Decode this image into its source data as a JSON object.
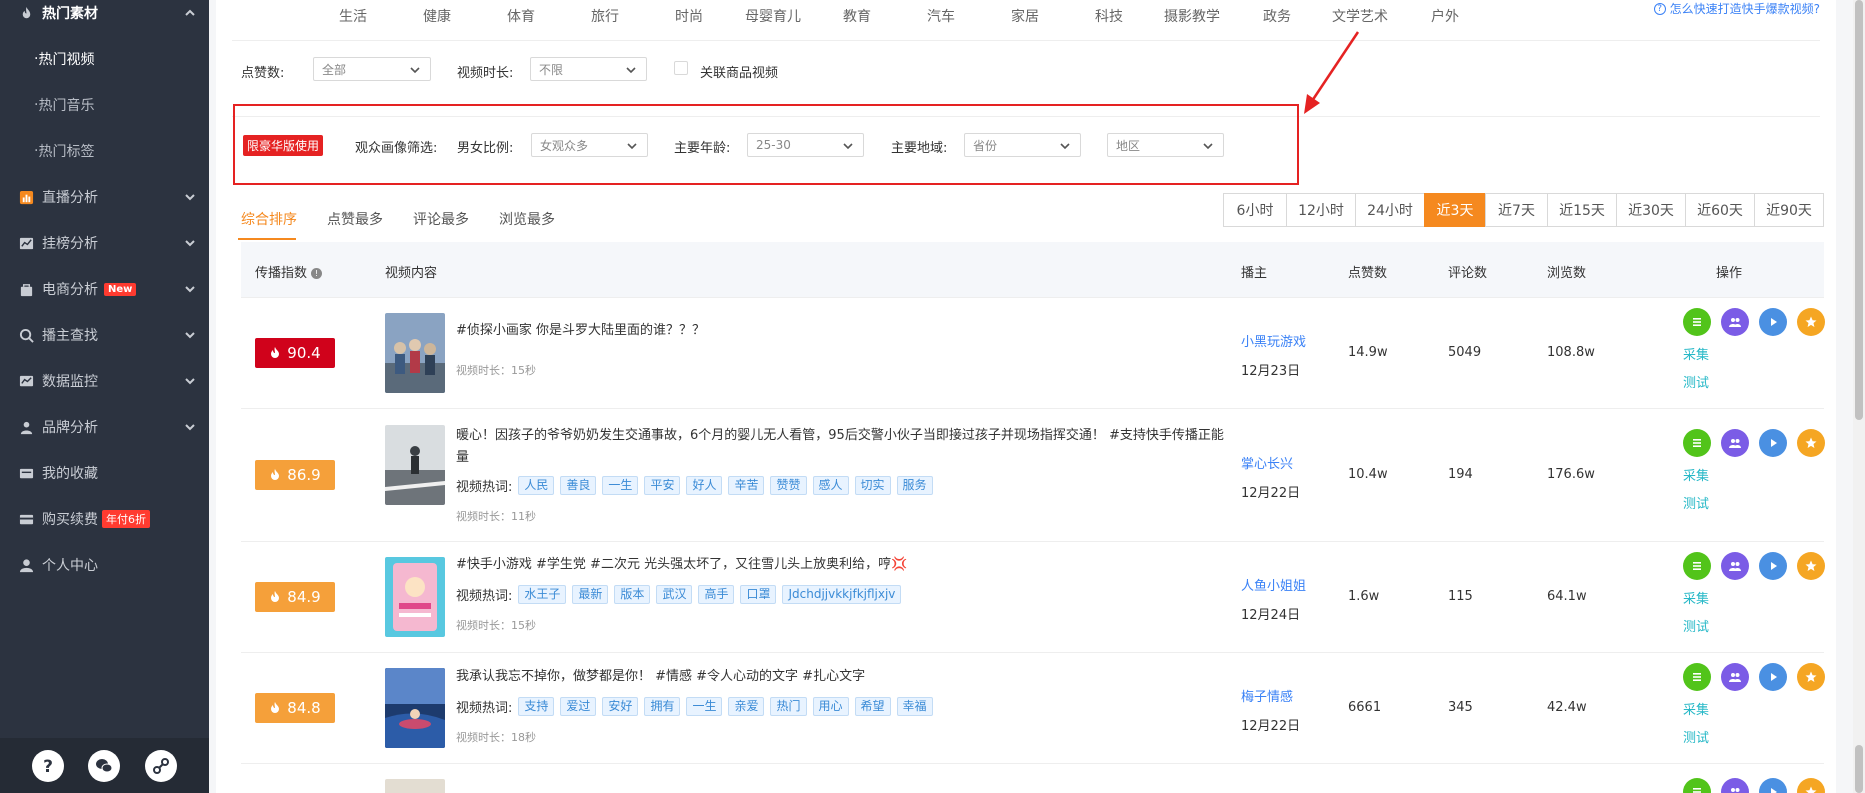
{
  "sidebar": {
    "items": [
      {
        "label": "热门素材",
        "icon": "flame-icon",
        "expanded": true
      },
      {
        "label": "热门视频",
        "sub": true,
        "active": true
      },
      {
        "label": "热门音乐",
        "sub": true
      },
      {
        "label": "热门标签",
        "sub": true
      },
      {
        "label": "直播分析",
        "icon": "bar-chart-icon"
      },
      {
        "label": "挂榜分析",
        "icon": "line-chart-icon"
      },
      {
        "label": "电商分析",
        "icon": "bag-icon",
        "badge": "New"
      },
      {
        "label": "播主查找",
        "icon": "search-icon"
      },
      {
        "label": "数据监控",
        "icon": "monitor-icon"
      },
      {
        "label": "品牌分析",
        "icon": "brand-icon"
      },
      {
        "label": "我的收藏",
        "icon": "collect-icon"
      },
      {
        "label": "购买续费",
        "icon": "card-icon",
        "badge": "年付6折"
      },
      {
        "label": "个人中心",
        "icon": "user-icon"
      }
    ],
    "bottom_icons": [
      "help-icon",
      "wechat-icon",
      "link-icon"
    ]
  },
  "categories": [
    "生活",
    "健康",
    "体育",
    "旅行",
    "时尚",
    "母婴育儿",
    "教育",
    "汽车",
    "家居",
    "科技",
    "摄影教学",
    "政务",
    "文学艺术",
    "户外"
  ],
  "help_link": "怎么快速打造快手爆款视频?",
  "filters": {
    "likes_label": "点赞数:",
    "likes_value": "全部",
    "duration_label": "视频时长:",
    "duration_value": "不限",
    "goods_label": "关联商品视频"
  },
  "audience": {
    "badge": "限豪华版使用",
    "label": "观众画像筛选:",
    "gender_label": "男女比例:",
    "gender_value": "女观众多",
    "age_label": "主要年龄:",
    "age_value": "25-30",
    "region_label": "主要地域:",
    "province_value": "省份",
    "area_value": "地区"
  },
  "tabs": [
    "综合排序",
    "点赞最多",
    "评论最多",
    "浏览最多"
  ],
  "time_ranges": [
    "6小时",
    "12小时",
    "24小时",
    "近3天",
    "近7天",
    "近15天",
    "近30天",
    "近60天",
    "近90天"
  ],
  "active_time": "近3天",
  "table": {
    "headers": [
      "传播指数",
      "视频内容",
      "播主",
      "点赞数",
      "评论数",
      "浏览数",
      "操作"
    ],
    "tags_label": "视频热词:",
    "rows": [
      {
        "score": "90.4",
        "color": "red",
        "title": "#侦探小画家 你是斗罗大陆里面的谁？？？",
        "tags": [],
        "duration": "视频时长：15秒",
        "author": "小黑玩游戏",
        "date": "12月23日",
        "likes": "14.9w",
        "comments": "5049",
        "views": "108.8w"
      },
      {
        "score": "86.9",
        "color": "orange",
        "title": "暖心！因孩子的爷爷奶奶发生交通事故，6个月的婴儿无人看管，95后交警小伙子当即接过孩子并现场指挥交通！ #支持快手传播正能量",
        "tags": [
          "人民",
          "善良",
          "一生",
          "平安",
          "好人",
          "辛苦",
          "赞赞",
          "感人",
          "切实",
          "服务"
        ],
        "duration": "视频时长：11秒",
        "author": "掌心长兴",
        "date": "12月22日",
        "likes": "10.4w",
        "comments": "194",
        "views": "176.6w"
      },
      {
        "score": "84.9",
        "color": "orange",
        "title": "#快手小游戏 #学生党 #二次元 光头强太坏了，又往雪儿头上放奥利给，哼💢",
        "tags": [
          "水王子",
          "最新",
          "版本",
          "武汉",
          "高手",
          "口罩",
          "Jdchdjjvkkjfkjfljxjv"
        ],
        "duration": "视频时长：15秒",
        "author": "人鱼小姐姐",
        "date": "12月24日",
        "likes": "1.6w",
        "comments": "115",
        "views": "64.1w"
      },
      {
        "score": "84.8",
        "color": "orange",
        "title": "我承认我忘不掉你，做梦都是你！ #情感 #令人心动的文字 #扎心文字",
        "tags": [
          "支持",
          "爱过",
          "安好",
          "拥有",
          "一生",
          "亲爱",
          "热门",
          "用心",
          "希望",
          "幸福"
        ],
        "duration": "视频时长：18秒",
        "author": "梅子情感",
        "date": "12月22日",
        "likes": "6661",
        "comments": "345",
        "views": "42.4w"
      }
    ],
    "op_links": [
      "采集",
      "测试"
    ]
  }
}
